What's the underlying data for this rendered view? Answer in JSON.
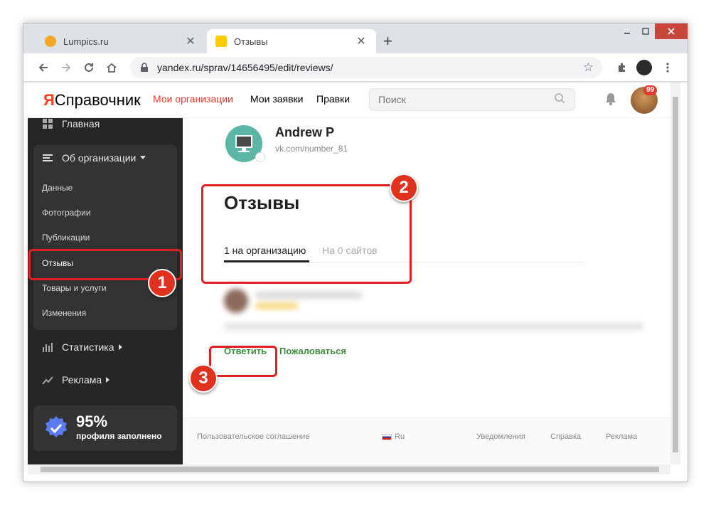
{
  "browser": {
    "tabs": [
      {
        "title": "Lumpics.ru",
        "close": "✕"
      },
      {
        "title": "Отзывы",
        "close": "✕"
      }
    ],
    "new_tab": "+",
    "url": "yandex.ru/sprav/14656495/edit/reviews/"
  },
  "header": {
    "logo_ya": "Я",
    "logo_text": "Справочник",
    "nav": [
      "Мои организации",
      "Мои заявки",
      "Правки"
    ],
    "search_placeholder": "Поиск",
    "notifications_count": "99"
  },
  "sidebar": {
    "home": "Главная",
    "about": "Об организации",
    "sub_items": [
      "Данные",
      "Фотографии",
      "Публикации",
      "Отзывы",
      "Товары и услуги",
      "Изменения"
    ],
    "statistics": "Статистика",
    "ads": "Реклама",
    "profile_percent": "95%",
    "profile_label": "профиля заполнено"
  },
  "main": {
    "org_name": "Andrew P",
    "org_link": "vk.com/number_81",
    "section_title": "Отзывы",
    "tabs": [
      "1 на организацию",
      "На 0 сайтов"
    ],
    "actions": {
      "reply": "Ответить",
      "report": "Пожаловаться"
    }
  },
  "footer": {
    "agreement": "Пользовательское соглашение",
    "lang": "Ru",
    "notifications": "Уведомления",
    "help": "Справка",
    "ads": "Реклама"
  },
  "annotations": [
    "1",
    "2",
    "3"
  ],
  "colors": {
    "accent_red": "#e6392d",
    "highlight": "#e02020",
    "action_green": "#3e8c3e",
    "sidebar_bg": "#262626"
  }
}
